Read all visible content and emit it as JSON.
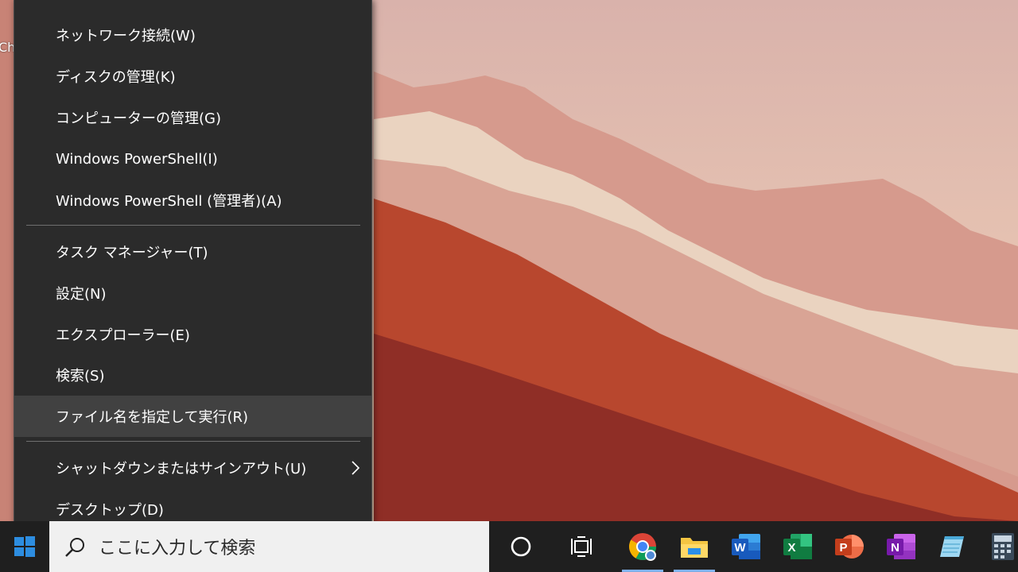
{
  "desktop": {
    "partial_label": "Ch"
  },
  "context_menu": {
    "items": [
      {
        "label": "ネットワーク接続(W)"
      },
      {
        "label": "ディスクの管理(K)"
      },
      {
        "label": "コンピューターの管理(G)"
      },
      {
        "label": "Windows PowerShell(I)"
      },
      {
        "label": "Windows PowerShell (管理者)(A)"
      },
      {
        "label": "タスク マネージャー(T)"
      },
      {
        "label": "設定(N)"
      },
      {
        "label": "エクスプローラー(E)"
      },
      {
        "label": "検索(S)"
      },
      {
        "label": "ファイル名を指定して実行(R)",
        "highlighted": true
      },
      {
        "label": "シャットダウンまたはサインアウト(U)",
        "has_submenu": true
      },
      {
        "label": "デスクトップ(D)"
      }
    ]
  },
  "taskbar": {
    "search_placeholder": "ここに入力して検索",
    "icons": [
      "windows-start-icon",
      "search-icon",
      "cortana-icon",
      "task-view-icon",
      "chrome-icon",
      "file-explorer-icon",
      "word-icon",
      "excel-icon",
      "powerpoint-icon",
      "onenote-icon",
      "notepad-icon",
      "calculator-icon"
    ],
    "running_apps": [
      "chrome",
      "file-explorer"
    ]
  },
  "colors": {
    "menu_bg": "#2b2b2b",
    "menu_highlight": "#414141",
    "taskbar_bg": "#1f1f1f",
    "accent_indicator": "#7fb1ea"
  }
}
